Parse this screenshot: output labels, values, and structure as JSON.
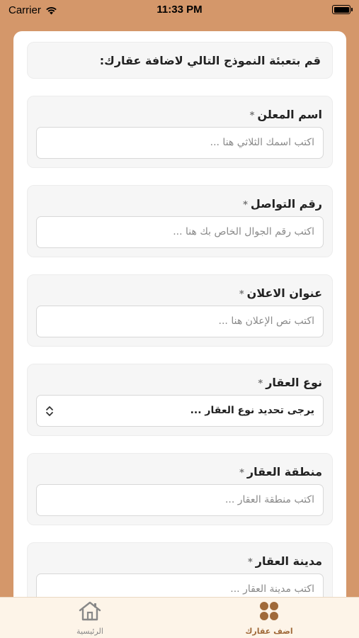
{
  "status_bar": {
    "carrier": "Carrier",
    "time": "11:33 PM"
  },
  "form": {
    "intro": "قم بتعبئة النموذج التالي لاضافة عقارك:",
    "required_mark": "*",
    "fields": [
      {
        "label": "اسم المعلن",
        "placeholder": "اكتب اسمك الثلاثي هنا ..."
      },
      {
        "label": "رقم التواصل",
        "placeholder": "اكتب رقم الجوال الخاص بك هنا ..."
      },
      {
        "label": "عنوان الاعلان",
        "placeholder": "اكتب نص الإعلان هنا ..."
      },
      {
        "label": "نوع العقار",
        "selected": "يرجى تحديد نوع العقار ..."
      },
      {
        "label": "منطقة العقار",
        "placeholder": "اكتب منطقة العقار ..."
      },
      {
        "label": "مدينة العقار",
        "placeholder": "اكتب مدينة العقار ..."
      }
    ]
  },
  "tab_bar": {
    "home_label": "الرئيسية",
    "add_label": "اضف عقارك",
    "active_color": "#a06a3a",
    "inactive_color": "#888888"
  },
  "colors": {
    "background": "#d4976a",
    "card": "#f6f6f6"
  }
}
